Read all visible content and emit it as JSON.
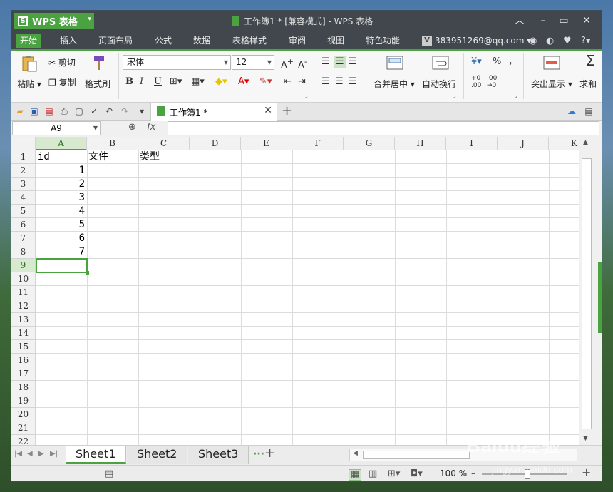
{
  "window": {
    "app_name": "WPS 表格",
    "title": "工作簿1 * [兼容模式] - WPS 表格",
    "minimize": "︿",
    "maximize": "▭",
    "close": "✕"
  },
  "menu": {
    "items": [
      "开始",
      "插入",
      "页面布局",
      "公式",
      "数据",
      "表格样式",
      "审阅",
      "视图",
      "特色功能"
    ],
    "active": "开始",
    "user": "383951269@qq.com",
    "user_badge": "V"
  },
  "ribbon": {
    "paste": "粘贴",
    "cut": "剪切",
    "copy": "复制",
    "format_painter": "格式刷",
    "font_name": "宋体",
    "font_size": "12",
    "merge_center": "合并居中",
    "wrap_text": "自动换行",
    "highlight": "突出显示",
    "sum": "求和",
    "percent": "%",
    "comma": "，",
    "bold": "B",
    "italic": "I",
    "underline": "U"
  },
  "doc_tab": {
    "name": "工作簿1 *",
    "close": "✕",
    "new": "+"
  },
  "formula": {
    "cell_ref": "A9",
    "fx": "fx",
    "value": ""
  },
  "grid": {
    "columns": [
      "A",
      "B",
      "C",
      "D",
      "E",
      "F",
      "G",
      "H",
      "I",
      "J",
      "K"
    ],
    "selected_column": "A",
    "rows": [
      "1",
      "2",
      "3",
      "4",
      "5",
      "6",
      "7",
      "8",
      "9",
      "10",
      "11",
      "12",
      "13",
      "14",
      "15",
      "16",
      "17",
      "18",
      "19",
      "20",
      "21",
      "22"
    ],
    "selected_row": "9",
    "headers": {
      "A1": "id",
      "B1": "文件",
      "C1": "类型"
    },
    "values": [
      "1",
      "2",
      "3",
      "4",
      "5",
      "6",
      "7"
    ]
  },
  "sheets": {
    "tabs": [
      "Sheet1",
      "Sheet2",
      "Sheet3"
    ],
    "active": "Sheet1",
    "more": "···",
    "add": "+"
  },
  "status": {
    "zoom": "100 %",
    "zoom_minus": "–",
    "zoom_plus": "+"
  },
  "watermark": {
    "text": "Baidu经验",
    "sub": "jingyan.baidu.com"
  },
  "colors": {
    "accent": "#4aa241",
    "titlebar": "#41474d"
  }
}
